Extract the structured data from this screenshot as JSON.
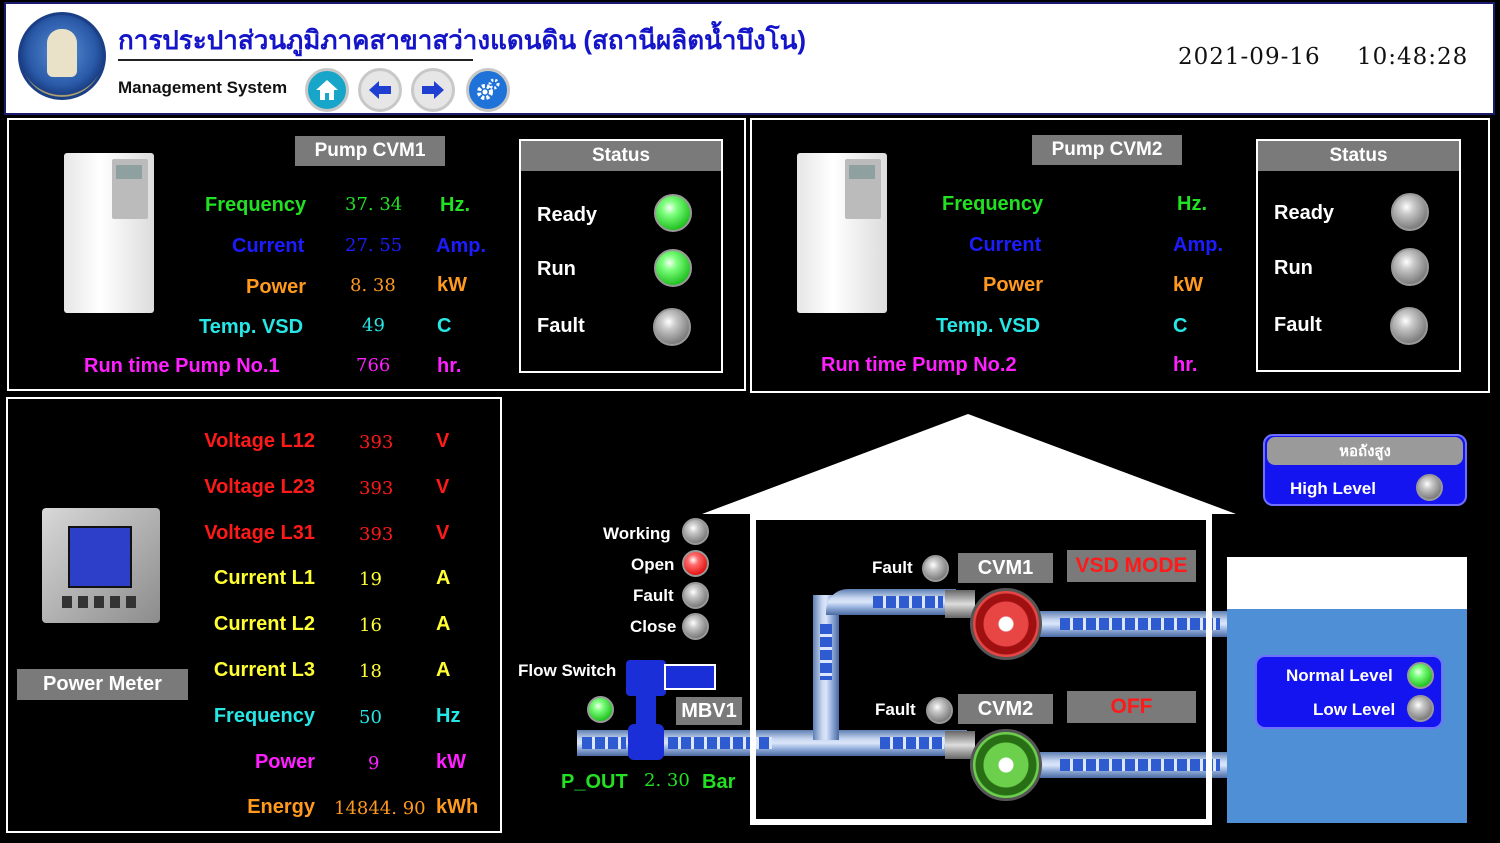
{
  "header": {
    "title": "การประปาส่วนภูมิภาคสาขาสว่างแดนดิน (สถานีผลิตน้ำบึงโน)",
    "subtitle": "Management System",
    "date": "2021-09-16",
    "time": "10:48:28"
  },
  "nav": {
    "home_icon": "home-icon",
    "back_icon": "arrow-left-icon",
    "forward_icon": "arrow-right-icon",
    "settings_icon": "gear-icon"
  },
  "colors": {
    "green": "#22e022",
    "blue": "#1c1cff",
    "orange": "#ff9a1f",
    "cyan": "#26e6e6",
    "magenta": "#ff1fff",
    "red": "#ff1a1a",
    "yellow": "#ffff33"
  },
  "pump1": {
    "title": "Pump CVM1",
    "rows": [
      {
        "label": "Frequency",
        "value": "37. 34",
        "unit": "Hz."
      },
      {
        "label": "Current",
        "value": "27. 55",
        "unit": "Amp."
      },
      {
        "label": "Power",
        "value": "8. 38",
        "unit": "kW"
      },
      {
        "label": "Temp. VSD",
        "value": "49",
        "unit": "C"
      },
      {
        "label": "Run time Pump No.1",
        "value": "766",
        "unit": "hr."
      }
    ],
    "status": {
      "title": "Status",
      "ready": "Ready",
      "run": "Run",
      "fault": "Fault",
      "ready_state": "on",
      "run_state": "on",
      "fault_state": "off"
    }
  },
  "pump2": {
    "title": "Pump CVM2",
    "rows": [
      {
        "label": "Frequency",
        "value": "",
        "unit": "Hz."
      },
      {
        "label": "Current",
        "value": "",
        "unit": "Amp."
      },
      {
        "label": "Power",
        "value": "",
        "unit": "kW"
      },
      {
        "label": "Temp. VSD",
        "value": "",
        "unit": "C"
      },
      {
        "label": "Run time Pump No.2",
        "value": "",
        "unit": "hr."
      }
    ],
    "status": {
      "title": "Status",
      "ready": "Ready",
      "run": "Run",
      "fault": "Fault",
      "ready_state": "off",
      "run_state": "off",
      "fault_state": "off"
    }
  },
  "meter": {
    "title": "Power Meter",
    "rows": [
      {
        "label": "Voltage L12",
        "value": "393",
        "unit": "V"
      },
      {
        "label": "Voltage L23",
        "value": "393",
        "unit": "V"
      },
      {
        "label": "Voltage L31",
        "value": "393",
        "unit": "V"
      },
      {
        "label": "Current L1",
        "value": "19",
        "unit": "A"
      },
      {
        "label": "Current L2",
        "value": "16",
        "unit": "A"
      },
      {
        "label": "Current L3",
        "value": "18",
        "unit": "A"
      },
      {
        "label": "Frequency",
        "value": "50",
        "unit": "Hz"
      },
      {
        "label": "Power",
        "value": "9",
        "unit": "kW"
      },
      {
        "label": "Energy",
        "value": "14844. 90",
        "unit": "kWh"
      }
    ]
  },
  "valve": {
    "working": "Working",
    "open": "Open",
    "fault": "Fault",
    "close": "Close",
    "flow_switch": "Flow Switch",
    "name": "MBV1",
    "p_out_label": "P_OUT",
    "p_out_value": "2. 30",
    "p_out_unit": "Bar",
    "open_state": "on"
  },
  "pumps_house": {
    "cvm1": "CVM1",
    "cvm2": "CVM2",
    "fault": "Fault",
    "cvm1_mode": "VSD MODE",
    "cvm2_mode": "OFF"
  },
  "tower": {
    "title": "หอถังสูง",
    "high": "High Level"
  },
  "tank": {
    "normal": "Normal Level",
    "low": "Low Level",
    "normal_state": "on",
    "low_state": "off"
  }
}
